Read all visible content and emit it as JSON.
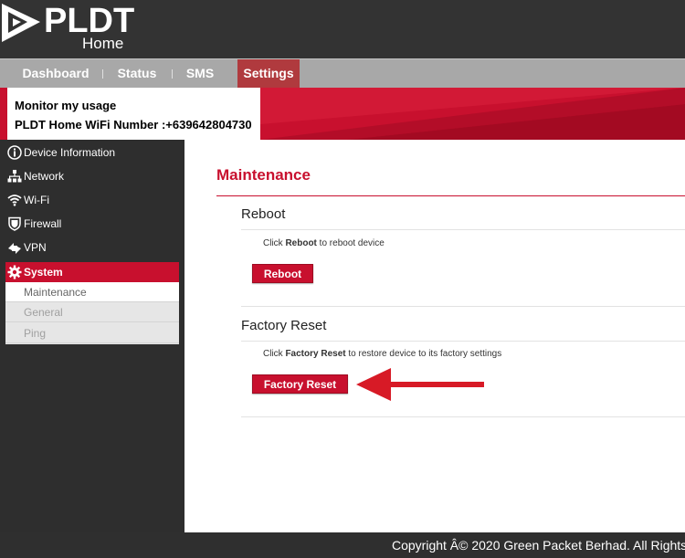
{
  "brand": {
    "name": "PLDT",
    "sub": "Home"
  },
  "nav": {
    "tabs": [
      {
        "label": "Dashboard"
      },
      {
        "label": "Status"
      },
      {
        "label": "SMS"
      },
      {
        "label": "Settings",
        "active": true
      }
    ]
  },
  "banner": {
    "line1": "Monitor my usage",
    "line2": "PLDT Home WiFi Number :+639642804730"
  },
  "sidebar": {
    "items": [
      {
        "label": "Device Information",
        "icon": "info-icon"
      },
      {
        "label": "Network",
        "icon": "network-icon"
      },
      {
        "label": "Wi-Fi",
        "icon": "wifi-icon"
      },
      {
        "label": "Firewall",
        "icon": "shield-icon"
      },
      {
        "label": "VPN",
        "icon": "vpn-icon"
      },
      {
        "label": "System",
        "icon": "gear-icon",
        "active": true
      }
    ],
    "submenu": [
      {
        "label": "Maintenance",
        "current": true
      },
      {
        "label": "General"
      },
      {
        "label": "Ping"
      }
    ]
  },
  "main": {
    "title": "Maintenance",
    "reboot": {
      "title": "Reboot",
      "desc_pre": "Click ",
      "desc_bold": "Reboot",
      "desc_post": " to reboot device",
      "button": "Reboot"
    },
    "factory": {
      "title": "Factory Reset",
      "desc_pre": "Click ",
      "desc_bold": "Factory Reset",
      "desc_post": " to restore device to its factory settings",
      "button": "Factory Reset"
    }
  },
  "footer": {
    "copyright": "Copyright Â© 2020 Green Packet Berhad. All Rights"
  },
  "colors": {
    "brand_red": "#c8102e",
    "active_tab": "#b03a3e",
    "nav_gray": "#a8a8a8",
    "dark": "#2f2f2f"
  }
}
